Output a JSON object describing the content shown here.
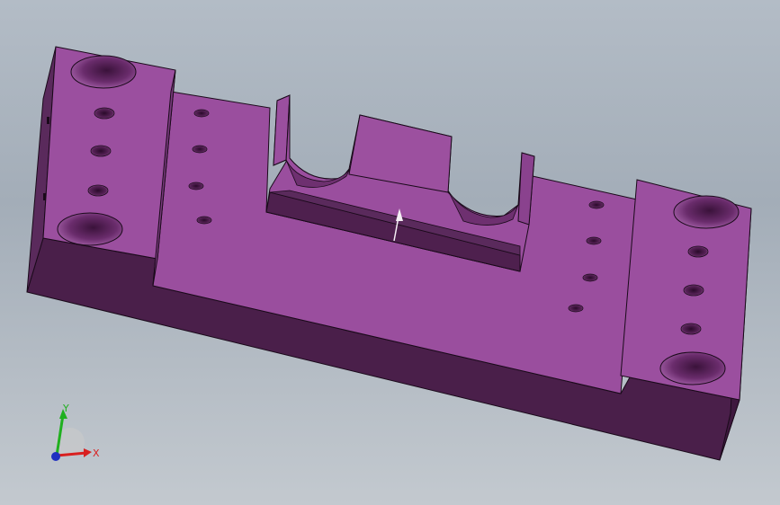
{
  "viewport": {
    "background_top": "#b3bcc6",
    "background_bottom": "#c3c9cf"
  },
  "part": {
    "color_top": "#9b4f9f",
    "color_side": "#4a1f4a",
    "edge_color": "#1a0a1a"
  },
  "triad": {
    "x_label": "X",
    "y_label": "Y",
    "x_color": "#d82020",
    "y_color": "#20b020",
    "z_color": "#2030c0"
  }
}
